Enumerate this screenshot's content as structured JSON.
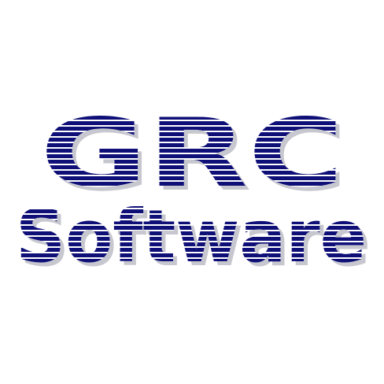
{
  "logo": {
    "line1": "GRC",
    "line2": "Software",
    "text_color": "#0f0f78",
    "stripe_color": "#ffffff",
    "background_color": "#ffffff"
  }
}
